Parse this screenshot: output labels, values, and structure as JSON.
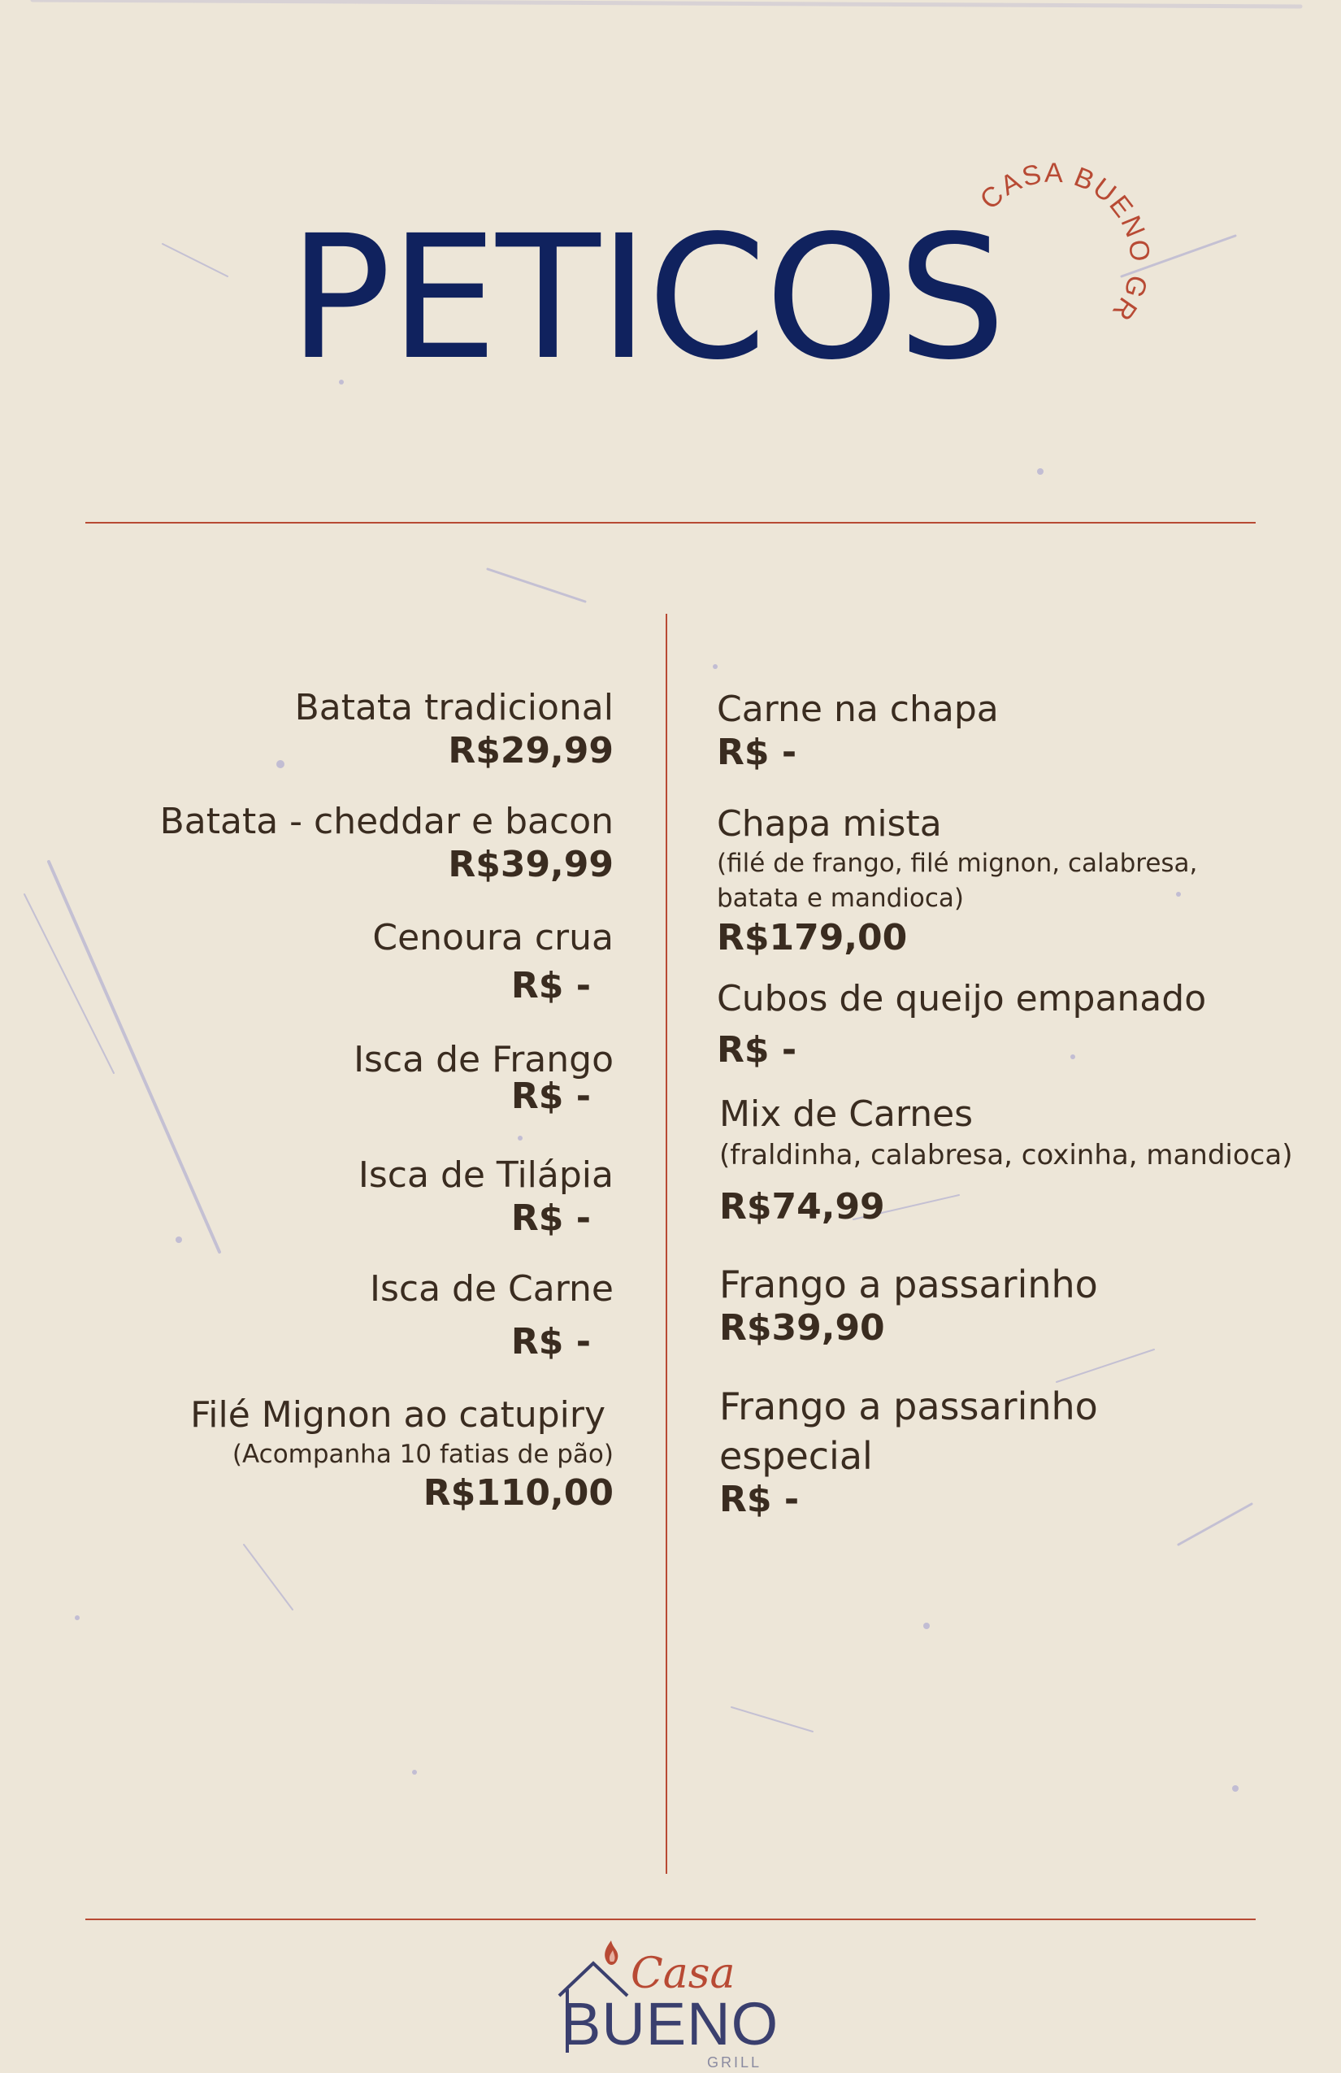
{
  "header": {
    "title": "PETICOS",
    "badge_text": "CASA BUENO GRILL"
  },
  "colors": {
    "background": "#ede6d8",
    "title": "#10225e",
    "accent": "#b84a34",
    "text": "#3a2c20"
  },
  "left_items": [
    {
      "name": "Batata tradicional",
      "desc": "",
      "price": "R$29,99"
    },
    {
      "name": "Batata - cheddar e bacon",
      "desc": "",
      "price": "R$39,99"
    },
    {
      "name": "Cenoura crua",
      "desc": "",
      "price": "R$ -"
    },
    {
      "name": "Isca de Frango",
      "desc": "",
      "price": "R$ -"
    },
    {
      "name": "Isca de Tilápia",
      "desc": "",
      "price": "R$ -"
    },
    {
      "name": "Isca de Carne",
      "desc": "",
      "price": "R$ -"
    },
    {
      "name": "Filé Mignon ao catupiry",
      "desc": "(Acompanha 10 fatias de pão)",
      "price": "R$110,00"
    }
  ],
  "right_items": [
    {
      "name": "Carne na chapa",
      "desc1": "",
      "desc2": "",
      "price": "R$ -"
    },
    {
      "name": "Chapa mista",
      "desc1": "(filé de frango, filé mignon, calabresa,",
      "desc2": "batata e mandioca)",
      "price": "R$179,00"
    },
    {
      "name": "Cubos de queijo empanado",
      "desc1": "",
      "desc2": "",
      "price": "R$ -"
    },
    {
      "name": "Mix de Carnes",
      "desc1": "(fraldinha, calabresa, coxinha, mandioca)",
      "desc2": "",
      "price": "R$74,99"
    },
    {
      "name": "Frango a passarinho",
      "desc1": "",
      "desc2": "",
      "price": "R$39,90"
    },
    {
      "name": "Frango a passarinho",
      "desc1": "especial",
      "desc2": "",
      "price": "R$ -"
    }
  ],
  "footer": {
    "logo_casa": "Casa",
    "logo_bueno": "BUENO",
    "logo_grill": "GRILL"
  }
}
